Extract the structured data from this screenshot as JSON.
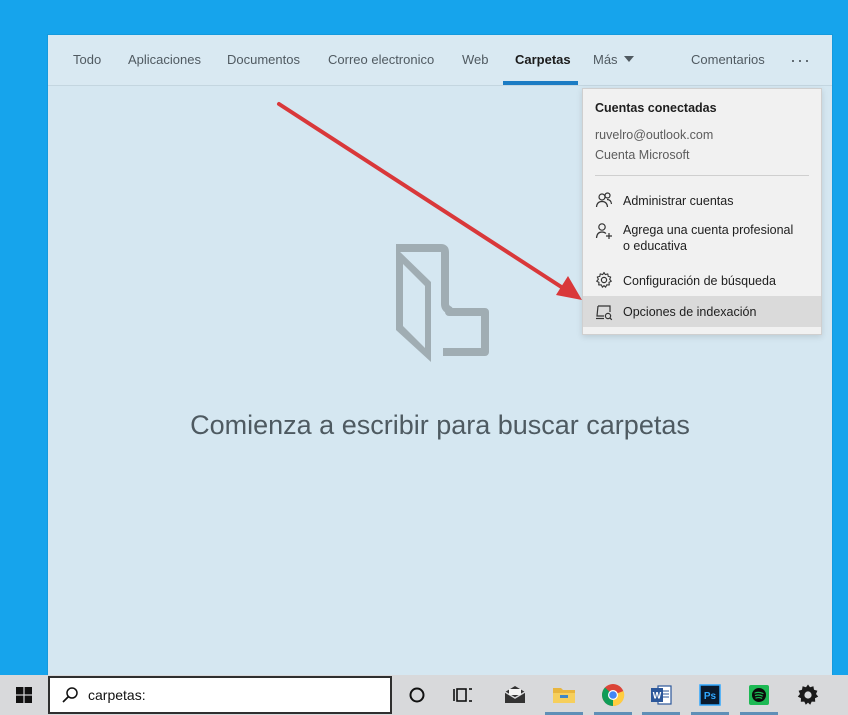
{
  "tabs": [
    {
      "label": "Todo"
    },
    {
      "label": "Aplicaciones"
    },
    {
      "label": "Documentos"
    },
    {
      "label": "Correo electronico"
    },
    {
      "label": "Web"
    },
    {
      "label": "Carpetas",
      "active": true
    },
    {
      "label": "Más"
    }
  ],
  "tabbar": {
    "feedback_label": "Comentarios",
    "more_options": "···"
  },
  "empty_state": {
    "icon": "folder-icon",
    "message": "Comienza a escribir para buscar carpetas"
  },
  "menu": {
    "title": "Cuentas conectadas",
    "email": "ruvelro@outlook.com",
    "account_type": "Cuenta Microsoft",
    "items": [
      {
        "label": "Administrar cuentas",
        "icon": "people-icon"
      },
      {
        "label_line1": "Agrega una cuenta profesional",
        "label_line2": "o educativa",
        "icon": "add-person-icon"
      },
      {
        "label": "Configuración de búsqueda",
        "icon": "gear-icon"
      },
      {
        "label": "Opciones de indexación",
        "icon": "indexing-icon",
        "highlighted": true
      }
    ]
  },
  "taskbar": {
    "search_value": "carpetas:",
    "apps": [
      "cortana-icon",
      "task-view-icon",
      "mail-icon",
      "file-explorer-icon",
      "chrome-icon",
      "word-icon",
      "photoshop-icon",
      "spotify-icon",
      "settings-icon"
    ]
  },
  "colors": {
    "desktop": "#16a4ec",
    "panel": "#d5e7f1",
    "accent": "#1b7cc4",
    "annotation_arrow": "#d9383a"
  }
}
